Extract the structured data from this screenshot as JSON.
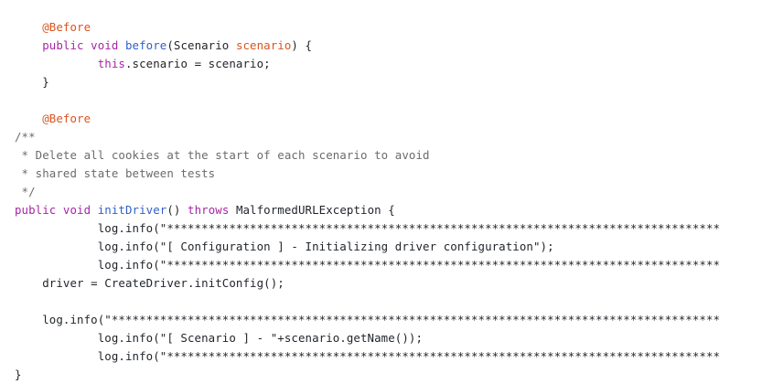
{
  "editor": {
    "colors": {
      "background": "#ffffff",
      "text": "#1f2328",
      "annotation": "#d9541e",
      "keyword": "#a626a4",
      "method": "#2f5fc8",
      "parameter": "#d9541e",
      "comment": "#6b6b6b"
    },
    "lines": [
      [
        {
          "t": "    "
        },
        {
          "t": "@Before",
          "k": "annotation"
        }
      ],
      [
        {
          "t": "    "
        },
        {
          "t": "public void ",
          "k": "keyword"
        },
        {
          "t": "before",
          "k": "method"
        },
        {
          "t": "(Scenario "
        },
        {
          "t": "scenario",
          "k": "param"
        },
        {
          "t": ") {"
        }
      ],
      [
        {
          "t": "            "
        },
        {
          "t": "this",
          "k": "keyword"
        },
        {
          "t": ".scenario = scenario;"
        }
      ],
      [
        {
          "t": "    }"
        }
      ],
      [
        {
          "t": ""
        }
      ],
      [
        {
          "t": "    "
        },
        {
          "t": "@Before",
          "k": "annotation"
        }
      ],
      [
        {
          "t": "/**",
          "k": "comment"
        }
      ],
      [
        {
          "t": " * Delete all cookies at the start of each scenario to avoid",
          "k": "comment"
        }
      ],
      [
        {
          "t": " * shared state between tests",
          "k": "comment"
        }
      ],
      [
        {
          "t": " */",
          "k": "comment"
        }
      ],
      [
        {
          "t": "public void ",
          "k": "keyword"
        },
        {
          "t": "initDriver",
          "k": "method"
        },
        {
          "t": "() "
        },
        {
          "t": "throws ",
          "k": "keyword"
        },
        {
          "t": "MalformedURLException {"
        }
      ],
      [
        {
          "t": "            log.info(\"********************************************************************************"
        }
      ],
      [
        {
          "t": "            log.info(\"[ Configuration ] - Initializing driver configuration\");"
        }
      ],
      [
        {
          "t": "            log.info(\"********************************************************************************"
        }
      ],
      [
        {
          "t": "    driver = CreateDriver.initConfig();"
        }
      ],
      [
        {
          "t": ""
        }
      ],
      [
        {
          "t": "    log.info(\"****************************************************************************************"
        }
      ],
      [
        {
          "t": "            log.info(\"[ Scenario ] - \"+scenario.getName());"
        }
      ],
      [
        {
          "t": "            log.info(\"********************************************************************************"
        }
      ],
      [
        {
          "t": "}"
        }
      ]
    ]
  }
}
